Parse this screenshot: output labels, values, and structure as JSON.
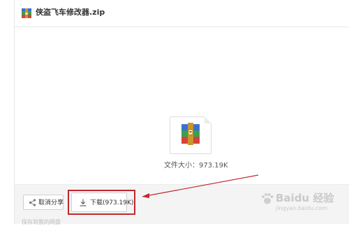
{
  "header": {
    "file_name": "侠盗飞车修改器.zip",
    "icon": "zip-archive-icon"
  },
  "preview": {
    "file_icon": "archive-file-icon",
    "file_size_text": "文件大小：973.19K"
  },
  "footer": {
    "cancel_share_label": "取消分享",
    "download_label": "下载(973.19K)",
    "bottom_text": "保存到我的网盘"
  },
  "watermark": {
    "logo_text": "Baidu 经验",
    "sub_text": "jingyan.baidu.com"
  },
  "colors": {
    "highlight": "#c0272d",
    "zip_blue": "#3d6fd1",
    "zip_red": "#d6433a",
    "zip_green": "#3aa14a",
    "zip_gold": "#c9962a"
  }
}
